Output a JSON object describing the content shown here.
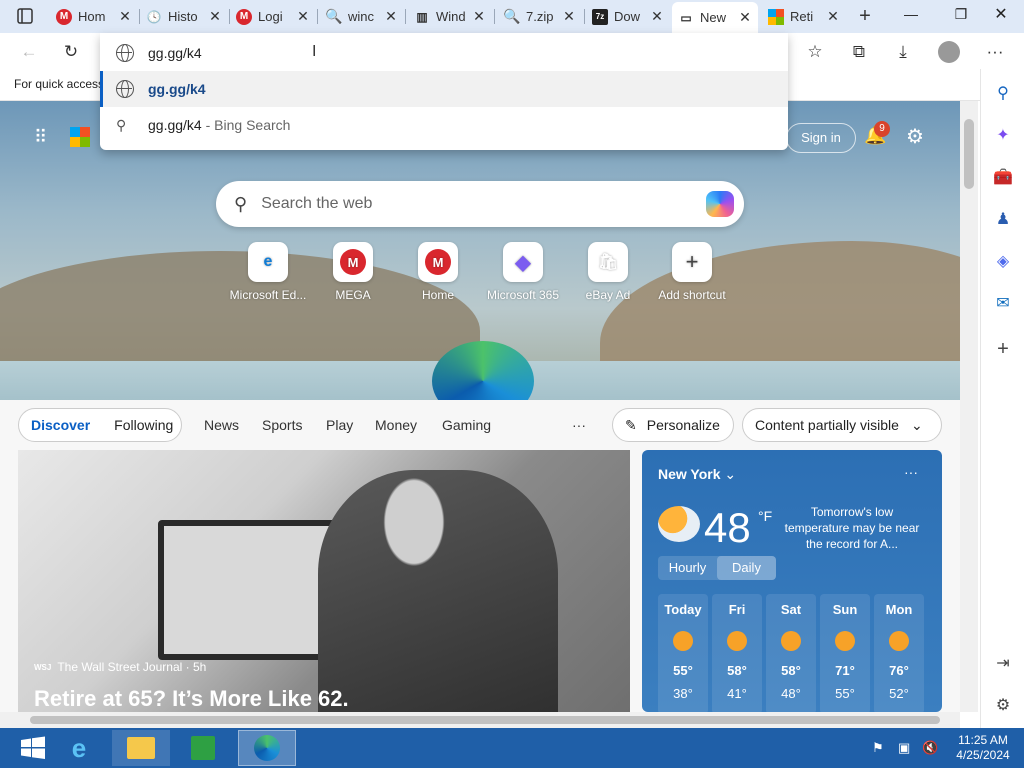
{
  "tabs": [
    {
      "label": "Hom",
      "icon": "mega-icon"
    },
    {
      "label": "Histo",
      "icon": "history-icon"
    },
    {
      "label": "Logi",
      "icon": "mega-icon"
    },
    {
      "label": "winc",
      "icon": "search-icon"
    },
    {
      "label": "Wind",
      "icon": "book-icon"
    },
    {
      "label": "7.zip",
      "icon": "search-icon"
    },
    {
      "label": "Dow",
      "icon": "7zip-icon"
    },
    {
      "label": "New",
      "icon": "newtab-icon",
      "active": true
    },
    {
      "label": "Reti",
      "icon": "microsoft-icon"
    }
  ],
  "address": {
    "value": "gg.gg/k4"
  },
  "favorites_bar": {
    "text": "For quick access"
  },
  "suggestions": [
    {
      "text": "gg.gg/k4",
      "type": "url"
    },
    {
      "text": "gg.gg/k4",
      "suffix": " - Bing Search",
      "type": "search"
    }
  ],
  "header": {
    "signin": "Sign in",
    "notif_count": "9"
  },
  "search": {
    "placeholder": "Search the web"
  },
  "quick_links": [
    {
      "label": "Microsoft Ed...",
      "glyph": "e",
      "color": "#0f7cd6"
    },
    {
      "label": "MEGA",
      "glyph": "M",
      "color": "#d9272e"
    },
    {
      "label": "Home",
      "glyph": "M",
      "color": "#d9272e"
    },
    {
      "label": "Microsoft 365",
      "glyph": "◆",
      "color": "#7b5cf0"
    },
    {
      "label": "eBay  Ad",
      "glyph": "🛍",
      "color": "#1a1a1a"
    },
    {
      "label": "Add shortcut",
      "glyph": "+",
      "color": "#444"
    }
  ],
  "feed": {
    "tabs": [
      "Discover",
      "Following"
    ],
    "nav": [
      "News",
      "Sports",
      "Play",
      "Money",
      "Gaming"
    ],
    "more": "···",
    "personalize": "Personalize",
    "content_visible": "Content partially visible"
  },
  "hero": {
    "source": "The Wall Street Journal · 5h",
    "source_badge": "WSJ",
    "headline": "Retire at 65? It’s More Like 62."
  },
  "weather": {
    "city": "New York",
    "temp": "48",
    "unit": "°F",
    "alert": "Tomorrow's low temperature may be near the record for A...",
    "toggle": [
      "Hourly",
      "Daily"
    ],
    "days": [
      {
        "day": "Today",
        "hi": "55°",
        "lo": "38°"
      },
      {
        "day": "Fri",
        "hi": "58°",
        "lo": "41°"
      },
      {
        "day": "Sat",
        "hi": "58°",
        "lo": "48°"
      },
      {
        "day": "Sun",
        "hi": "71°",
        "lo": "55°"
      },
      {
        "day": "Mon",
        "hi": "76°",
        "lo": "52°"
      }
    ]
  },
  "taskbar": {
    "time": "11:25 AM",
    "date": "4/25/2024"
  }
}
